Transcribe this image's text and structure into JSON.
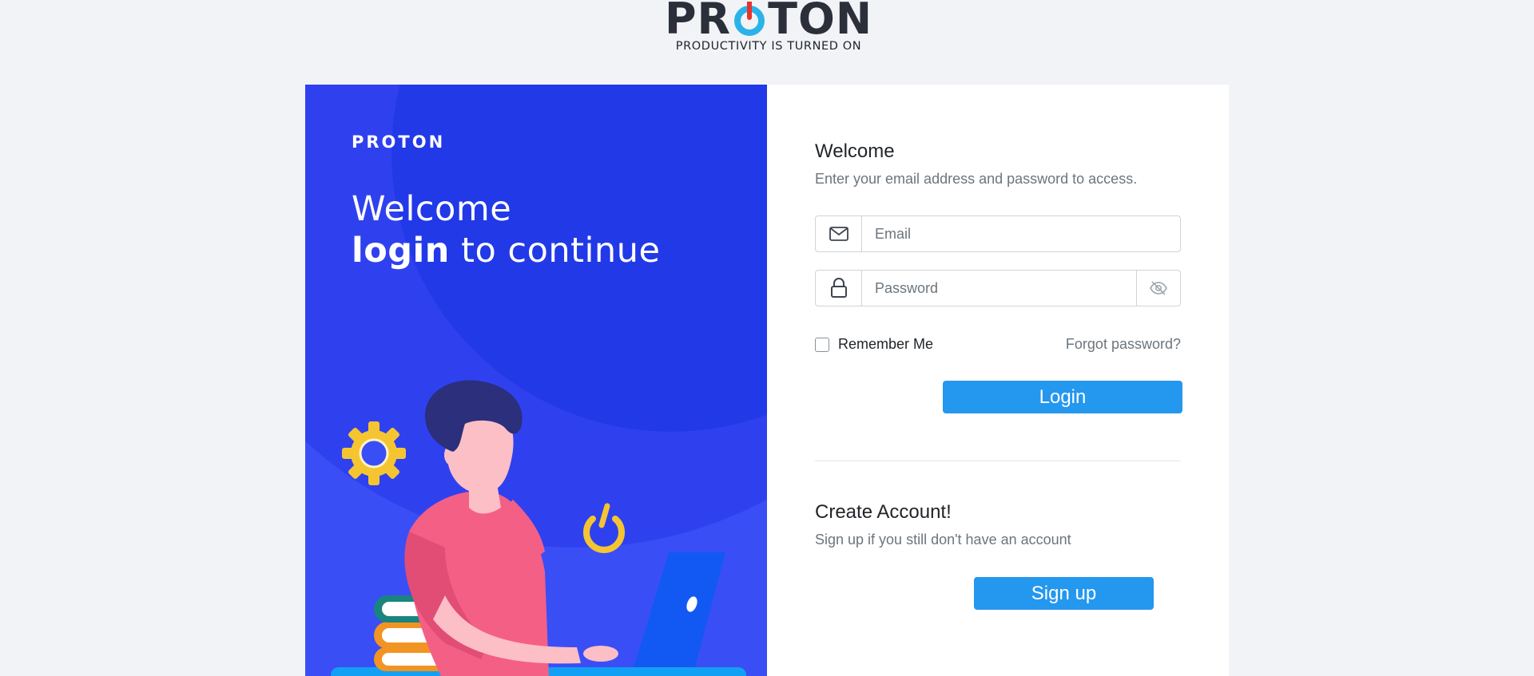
{
  "logo": {
    "wordmark_left": "PR",
    "wordmark_right": "TON",
    "tagline": "PRODUCTIVITY IS TURNED ON"
  },
  "hero": {
    "brand": "PROTON",
    "headline_line1": "Welcome",
    "headline_bold": "login",
    "headline_rest": " to continue"
  },
  "login_form": {
    "title": "Welcome",
    "subtitle": "Enter your email address and password to access.",
    "email_placeholder": "Email",
    "password_placeholder": "Password",
    "remember_label": "Remember Me",
    "remember_checked": false,
    "forgot_label": "Forgot password?",
    "login_label": "Login"
  },
  "signup": {
    "title": "Create Account!",
    "subtitle": "Sign up if you still don't have an account",
    "button_label": "Sign up"
  },
  "icons": {
    "email": "envelope-icon",
    "password": "lock-icon",
    "toggle": "eye-slash-icon"
  },
  "colors": {
    "page_bg": "#f2f3f7",
    "hero_bg": "#3a4ef6",
    "primary_button": "#2497ef",
    "logo_red": "#e8322d",
    "logo_cyan": "#2bb3e8"
  }
}
